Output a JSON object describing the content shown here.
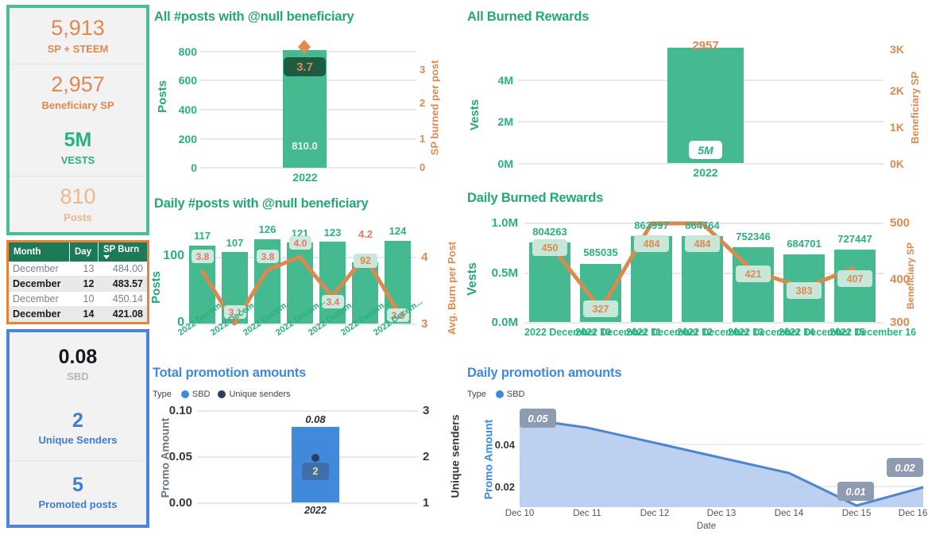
{
  "sidebar": {
    "kpi_green": {
      "items": [
        {
          "value": "5,913",
          "label": "SP + STEEM"
        },
        {
          "value": "2,957",
          "label": "Beneficiary SP"
        },
        {
          "value": "5M",
          "label": "VESTS"
        },
        {
          "value": "810",
          "label": "Posts"
        }
      ]
    },
    "burn_table": {
      "columns": [
        "Month",
        "Day",
        "SP Burn"
      ],
      "sort_column": "SP Burn",
      "sort_direction": "desc",
      "rows": [
        {
          "month": "December",
          "day": "13",
          "sp_burn": "484.00"
        },
        {
          "month": "December",
          "day": "12",
          "sp_burn": "483.57"
        },
        {
          "month": "December",
          "day": "10",
          "sp_burn": "450.14"
        },
        {
          "month": "December",
          "day": "14",
          "sp_burn": "421.08"
        }
      ]
    },
    "kpi_blue": {
      "items": [
        {
          "value": "0.08",
          "label": "SBD"
        },
        {
          "value": "2",
          "label": "Unique Senders"
        },
        {
          "value": "5",
          "label": "Promoted posts"
        }
      ]
    }
  },
  "chart_data": [
    {
      "id": "all_posts_null_beneficiary",
      "type": "bar",
      "title": "All #posts with @null beneficiary",
      "categories": [
        "2022"
      ],
      "xlabel": "",
      "ylabel": "Posts",
      "ylim": [
        0,
        800
      ],
      "yticks": [
        "0",
        "200",
        "400",
        "600",
        "800"
      ],
      "y2label": "SP burned per post",
      "y2lim": [
        0,
        3
      ],
      "y2ticks": [
        "0",
        "1",
        "2",
        "3"
      ],
      "series": [
        {
          "name": "Posts",
          "values": [
            810.0
          ],
          "labels": [
            "810.0"
          ]
        },
        {
          "name": "SP burned per post",
          "values": [
            3.7
          ],
          "labels": [
            "3.7"
          ],
          "marker": "diamond"
        }
      ],
      "grid": true
    },
    {
      "id": "all_burned_rewards",
      "type": "bar",
      "title": "All Burned Rewards",
      "categories": [
        "2022"
      ],
      "xlabel": "",
      "ylabel": "Vests",
      "ylim": [
        0,
        4000000
      ],
      "yticks": [
        "0M",
        "2M",
        "4M"
      ],
      "y2label": "Beneficiary SP",
      "y2lim": [
        0,
        3000
      ],
      "y2ticks": [
        "0K",
        "1K",
        "2K",
        "3K"
      ],
      "series": [
        {
          "name": "Vests",
          "values": [
            5000000
          ],
          "labels": [
            "5M"
          ]
        },
        {
          "name": "Beneficiary SP",
          "values": [
            2957
          ],
          "labels": [
            "2957"
          ]
        }
      ],
      "grid": true
    },
    {
      "id": "daily_posts_null_beneficiary",
      "type": "bar",
      "title": "Daily #posts with @null beneficiary",
      "categories": [
        "2022 Decem...",
        "2022 Decem...",
        "2022 Decem...",
        "2022 Decem...",
        "2022 Decem...",
        "2022 Decem...",
        "2022 Decem..."
      ],
      "xlabel": "",
      "ylabel": "Posts",
      "ylim": [
        0,
        130
      ],
      "yticks": [
        "0",
        "100"
      ],
      "y2label": "Avg. Burn per Post",
      "y2lim": [
        3,
        4
      ],
      "y2ticks": [
        "3",
        "4"
      ],
      "series": [
        {
          "name": "Posts",
          "values": [
            117,
            107,
            126,
            121,
            123,
            92,
            124
          ],
          "labels": [
            "117",
            "107",
            "126",
            "121",
            "123",
            "92",
            "124"
          ]
        },
        {
          "name": "Avg. Burn per Post",
          "values": [
            3.8,
            3.1,
            3.8,
            4.0,
            3.4,
            4.2,
            3.3
          ],
          "labels": [
            "3.8",
            "3.1",
            "3.8",
            "4.0",
            "3.4",
            "4.2",
            "3.3"
          ]
        }
      ],
      "grid": true
    },
    {
      "id": "daily_burned_rewards",
      "type": "bar",
      "title": "Daily Burned Rewards",
      "categories": [
        "2022 December 10",
        "2022 December 11",
        "2022 December 12",
        "2022 December 13",
        "2022 December 14",
        "2022 December 15",
        "2022 December 16"
      ],
      "xlabel": "",
      "ylabel": "Vests",
      "ylim": [
        0,
        1000000
      ],
      "yticks": [
        "0.0M",
        "0.5M",
        "1.0M"
      ],
      "y2label": "Beneficiary SP",
      "y2lim": [
        300,
        500
      ],
      "y2ticks": [
        "300",
        "400",
        "500"
      ],
      "series": [
        {
          "name": "Vests",
          "values": [
            804263,
            585035,
            863997,
            864764,
            752346,
            684701,
            727447
          ],
          "labels": [
            "804263",
            "585035",
            "863997",
            "864764",
            "752346",
            "684701",
            "727447"
          ]
        },
        {
          "name": "Beneficiary SP",
          "values": [
            450,
            327,
            484,
            484,
            421,
            383,
            407
          ],
          "labels": [
            "450",
            "327",
            "484",
            "484",
            "421",
            "383",
            "407"
          ]
        }
      ],
      "grid": true
    },
    {
      "id": "total_promotion_amounts",
      "type": "bar",
      "title": "Total promotion amounts",
      "legend_title": "Type",
      "legend": [
        {
          "label": "SBD",
          "color": "#4089DB"
        },
        {
          "label": "Unique senders",
          "color": "#2C3E63"
        }
      ],
      "legend_position": "top-left",
      "categories": [
        "2022"
      ],
      "xlabel": "",
      "ylabel": "Promo Amount",
      "ylim": [
        0.0,
        0.1
      ],
      "yticks": [
        "0.00",
        "0.05",
        "0.10"
      ],
      "y2label": "Unique senders",
      "y2lim": [
        1,
        3
      ],
      "y2ticks": [
        "1",
        "2",
        "3"
      ],
      "series": [
        {
          "name": "SBD",
          "values": [
            0.08
          ],
          "labels": [
            "0.08"
          ]
        },
        {
          "name": "Unique senders",
          "values": [
            2
          ],
          "labels": [
            "2"
          ]
        }
      ],
      "grid": true
    },
    {
      "id": "daily_promotion_amounts",
      "type": "area",
      "title": "Daily promotion amounts",
      "legend_title": "Type",
      "legend": [
        {
          "label": "SBD",
          "color": "#4089DB"
        }
      ],
      "legend_position": "top-left",
      "x": [
        "Dec 10",
        "Dec 11",
        "Dec 12",
        "Dec 13",
        "Dec 14",
        "Dec 15",
        "Dec 16"
      ],
      "xlabel": "Date",
      "ylabel": "Promo Amount",
      "ylim": [
        0.008,
        0.05
      ],
      "yticks": [
        "0.02",
        "0.04"
      ],
      "series": [
        {
          "name": "SBD",
          "values": [
            0.05,
            0.043,
            0.036,
            0.029,
            0.022,
            0.01,
            0.021
          ],
          "point_labels": {
            "0": "0.05",
            "5": "0.01",
            "6": "0.02"
          }
        }
      ],
      "grid": true
    }
  ]
}
